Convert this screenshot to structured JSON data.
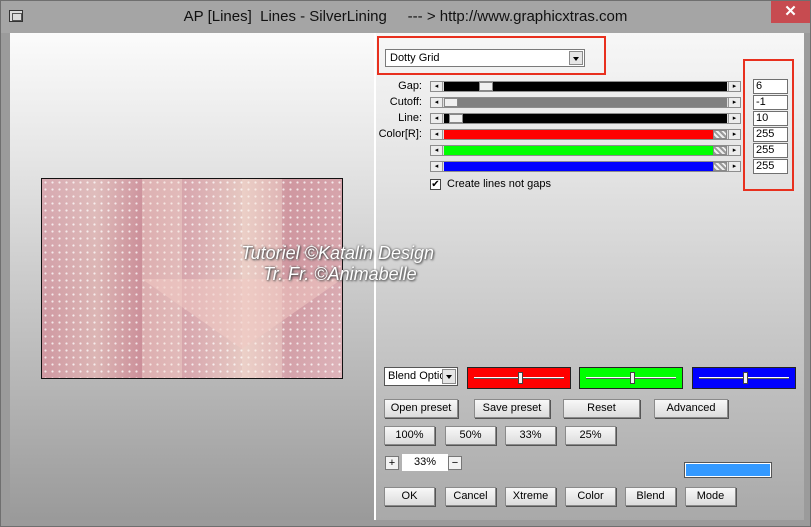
{
  "window": {
    "title": "AP [Lines]  Lines - SilverLining     --- > http://www.graphicxtras.com",
    "close_glyph": "✕"
  },
  "watermark": {
    "line1": "Tutoriel ©Katalin Design",
    "line2": "Tr. Fr. ©Animabelle"
  },
  "effect_select": {
    "value": "Dotty Grid"
  },
  "params": [
    {
      "label": "Gap:",
      "value": "6",
      "level": 0.13,
      "track_color": "#000000",
      "fill": "#000000"
    },
    {
      "label": "Cutoff:",
      "value": "-1",
      "level": 0.0,
      "track_color": "#808080",
      "fill": "#808080"
    },
    {
      "label": "Line:",
      "value": "10",
      "level": 0.02,
      "track_color": "#000000",
      "fill": "#000000"
    },
    {
      "label": "Color[R]:",
      "value": "255",
      "level": 1.0,
      "track_color": "#ff0000",
      "fill": "#ff0000"
    },
    {
      "label": "",
      "value": "255",
      "level": 1.0,
      "track_color": "#00ff00",
      "fill": "#00ff00"
    },
    {
      "label": "",
      "value": "255",
      "level": 1.0,
      "track_color": "#0000ff",
      "fill": "#0000ff"
    }
  ],
  "create_lines": {
    "label": "Create lines not gaps",
    "checked": true,
    "mark": "✔"
  },
  "blend": {
    "select_value": "Blend Options",
    "panels": [
      {
        "color": "#ff0000",
        "level": 0.5
      },
      {
        "color": "#00ff00",
        "level": 0.5
      },
      {
        "color": "#0000ff",
        "level": 0.5
      }
    ]
  },
  "buttons_row1": [
    "Open preset",
    "Save preset",
    "Reset",
    "Advanced"
  ],
  "zoom_buttons": [
    "100%",
    "50%",
    "33%",
    "25%"
  ],
  "zoom": {
    "plus": "+",
    "minus": "−",
    "value": "33%"
  },
  "swatch_color": "#3399ff",
  "bottom_buttons": [
    "OK",
    "Cancel",
    "Xtreme",
    "Color",
    "Blend",
    "Mode"
  ]
}
